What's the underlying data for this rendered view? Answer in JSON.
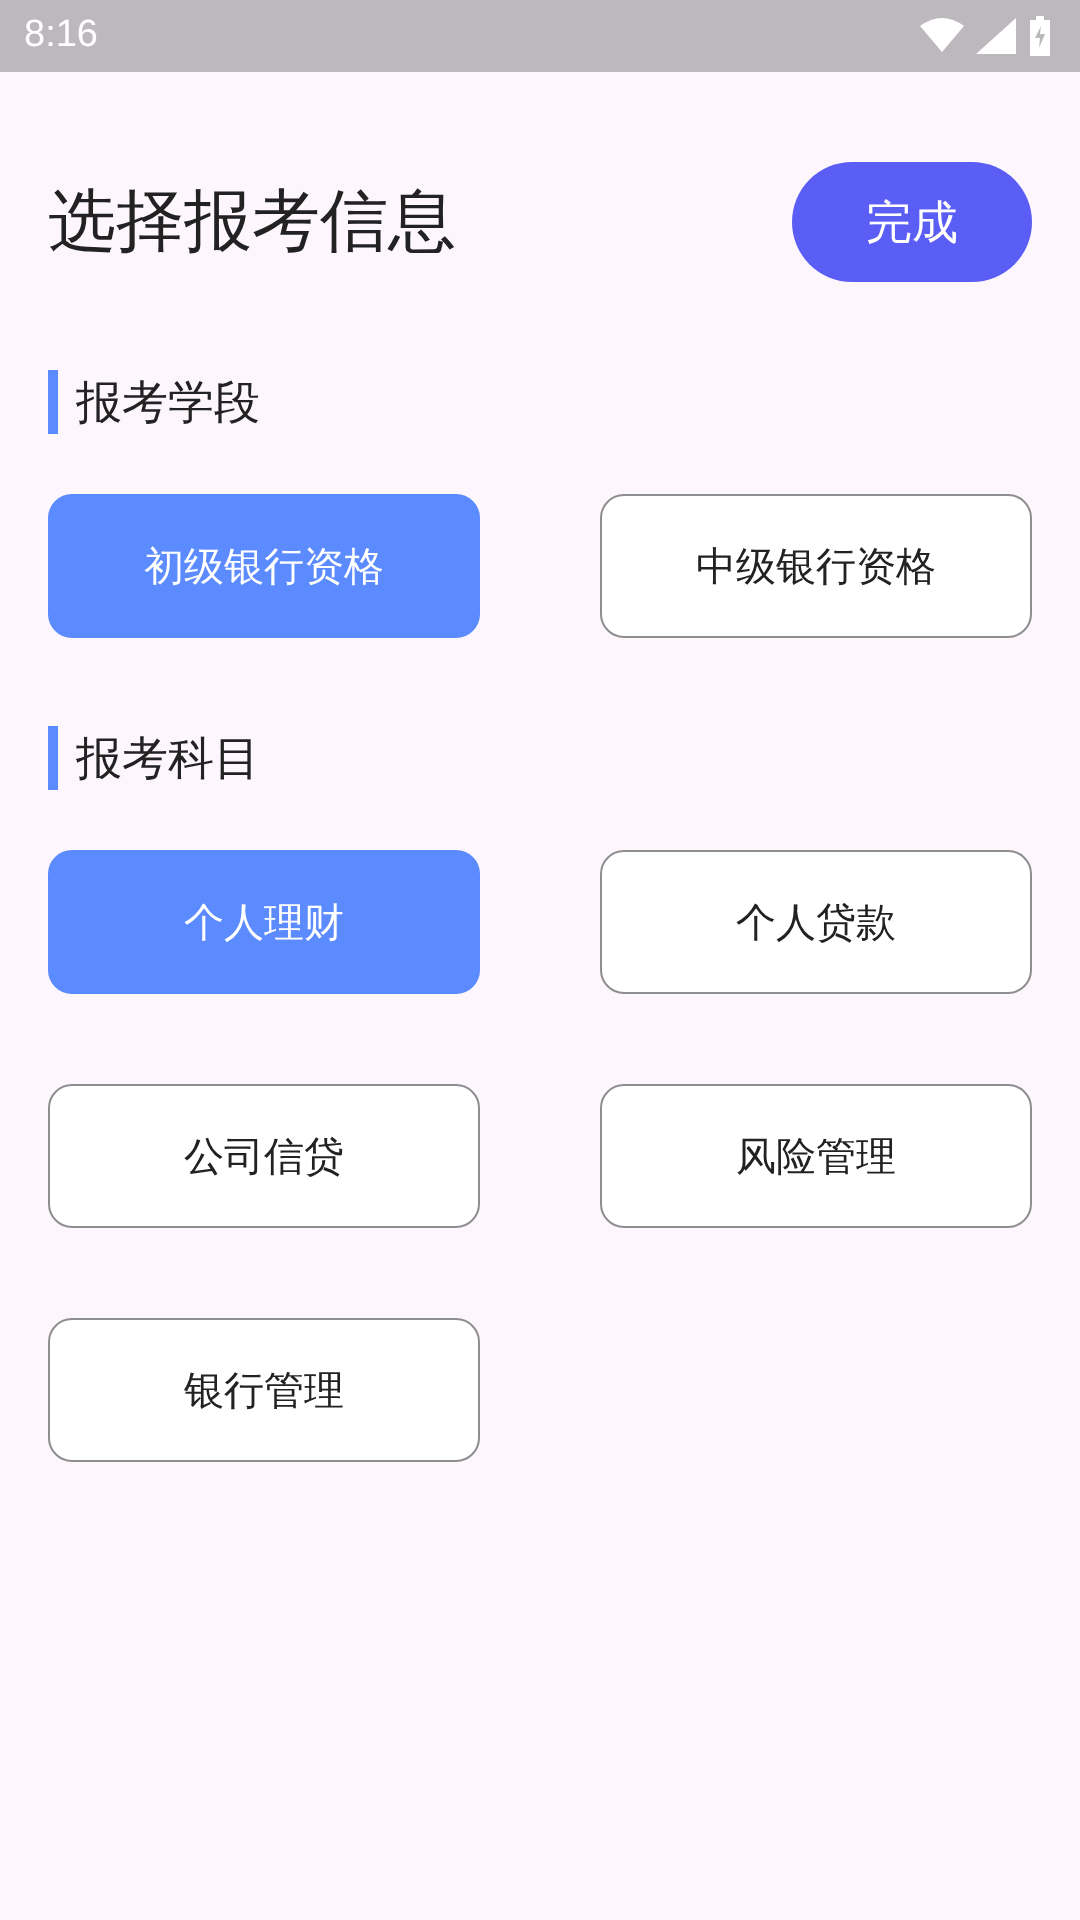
{
  "status_bar": {
    "time": "8:16"
  },
  "header": {
    "title": "选择报考信息",
    "done_button": "完成"
  },
  "sections": [
    {
      "title": "报考学段",
      "options": [
        {
          "label": "初级银行资格",
          "selected": true
        },
        {
          "label": "中级银行资格",
          "selected": false
        }
      ]
    },
    {
      "title": "报考科目",
      "options": [
        {
          "label": "个人理财",
          "selected": true
        },
        {
          "label": "个人贷款",
          "selected": false
        },
        {
          "label": "公司信贷",
          "selected": false
        },
        {
          "label": "风险管理",
          "selected": false
        },
        {
          "label": "银行管理",
          "selected": false
        }
      ]
    }
  ]
}
